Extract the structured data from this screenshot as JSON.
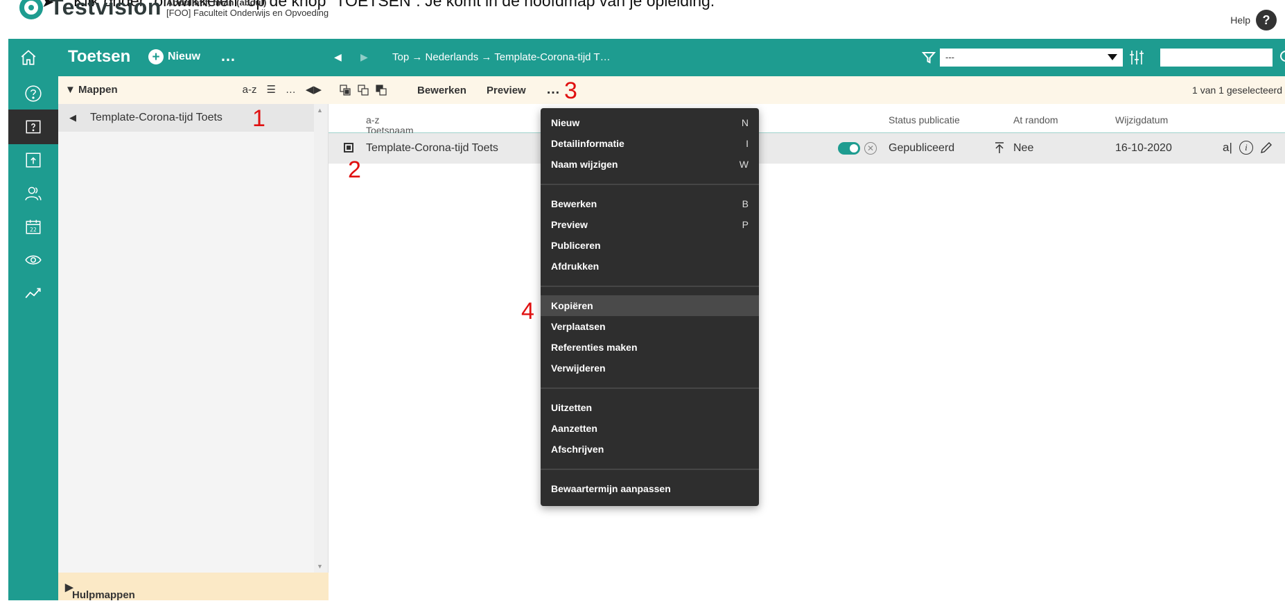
{
  "instruction": "Klik onder “ontwikkelen” op de knop “TOETSEN”. Je komt  in de hoofdmap van je opleiding.",
  "brand": {
    "name": "Testvision",
    "user_name": "Abdullatif, Iman (abdul)",
    "faculty": "[FOO] Faculteit Onderwijs en Opvoeding",
    "help": "Help",
    "help_glyph": "?"
  },
  "header": {
    "title": "Toetsen",
    "new_label": "Nieuw",
    "dots": "…",
    "breadcrumb": "Top → Nederlands → Template-Corona-tijd T…",
    "filter_value": "---",
    "search_placeholder": ""
  },
  "rail": {
    "items": [
      "home-icon",
      "help-circle-icon",
      "tests-icon",
      "export-icon",
      "users-icon",
      "calendar-icon",
      "eye-icon",
      "chart-icon"
    ],
    "active": "tests-icon"
  },
  "folders": {
    "title": "Mappen",
    "sort": "a-z",
    "dots": "…",
    "items": [
      {
        "label": "Template-Corona-tijd Toets"
      }
    ],
    "help_folders": "Hulpmappen"
  },
  "toolbar": {
    "edit": "Bewerken",
    "preview": "Preview",
    "dots": "…",
    "count": "1 van 1 geselecteerd"
  },
  "columns": {
    "name": "Toetsnaam",
    "name_sort": "a-z",
    "status": "Status publicatie",
    "random": "At random",
    "date": "Wijzigdatum"
  },
  "rows": [
    {
      "name": "Template-Corona-tijd Toets",
      "status": "Gepubliceerd",
      "random": "Nee",
      "date": "16-10-2020",
      "action_a": "a|"
    }
  ],
  "annotations": [
    "1",
    "2",
    "3",
    "4"
  ],
  "menu": {
    "group1": [
      {
        "label": "Nieuw",
        "key": "N"
      },
      {
        "label": "Detailinformatie",
        "key": "I"
      },
      {
        "label": "Naam wijzigen",
        "key": "W"
      }
    ],
    "group2": [
      {
        "label": "Bewerken",
        "key": "B"
      },
      {
        "label": "Preview",
        "key": "P"
      },
      {
        "label": "Publiceren",
        "key": ""
      },
      {
        "label": "Afdrukken",
        "key": ""
      }
    ],
    "group3": [
      {
        "label": "Kopiëren",
        "key": ""
      },
      {
        "label": "Verplaatsen",
        "key": ""
      },
      {
        "label": "Referenties maken",
        "key": ""
      },
      {
        "label": "Verwijderen",
        "key": ""
      }
    ],
    "group4": [
      {
        "label": "Uitzetten",
        "key": ""
      },
      {
        "label": "Aanzetten",
        "key": ""
      },
      {
        "label": "Afschrijven",
        "key": ""
      }
    ],
    "group5": [
      {
        "label": "Bewaartermijn aanpassen",
        "key": ""
      }
    ],
    "highlighted": "Kopiëren"
  },
  "colors": {
    "teal": "#1e9c90",
    "annotation": "#e01010",
    "menu_bg": "#2e2e2e"
  }
}
